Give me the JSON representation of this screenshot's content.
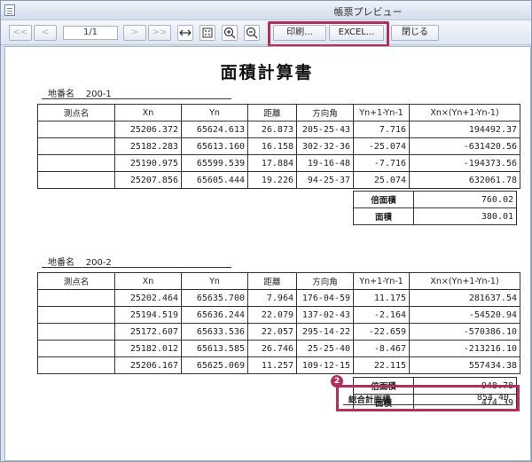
{
  "window": {
    "title": "帳票プレビュー"
  },
  "toolbar": {
    "first": "<<",
    "prev": "<",
    "page": "1/1",
    "next": ">",
    "last": ">>",
    "print_label": "印刷...",
    "excel_label": "EXCEL...",
    "close_label": "閉じる"
  },
  "document": {
    "title": "面積計算書",
    "columns": [
      "測点名",
      "Xn",
      "Yn",
      "距離",
      "方向角",
      "Yn+1-Yn-1",
      "Xn×(Yn+1-Yn-1)"
    ],
    "sum_labels": {
      "double_area": "倍面積",
      "area": "面積"
    },
    "total_label": "総合計面積",
    "total_value": "854.40",
    "badge": "2",
    "lots": [
      {
        "label": "地番名",
        "name": "200-1",
        "rows": [
          [
            "",
            "25206.372",
            "65624.613",
            "26.873",
            "205-25-43",
            "7.716",
            "194492.37"
          ],
          [
            "",
            "25182.283",
            "65613.160",
            "16.158",
            "302-32-36",
            "-25.074",
            "-631420.56"
          ],
          [
            "",
            "25190.975",
            "65599.539",
            "17.884",
            "19-16-48",
            "-7.716",
            "-194373.56"
          ],
          [
            "",
            "25207.856",
            "65605.444",
            "19.226",
            "94-25-37",
            "25.074",
            "632061.78"
          ]
        ],
        "double_area": "760.02",
        "area": "380.01"
      },
      {
        "label": "地番名",
        "name": "200-2",
        "rows": [
          [
            "",
            "25202.464",
            "65635.700",
            "7.964",
            "176-04-59",
            "11.175",
            "281637.54"
          ],
          [
            "",
            "25194.519",
            "65636.244",
            "22.079",
            "137-02-43",
            "-2.164",
            "-54520.94"
          ],
          [
            "",
            "25172.607",
            "65633.536",
            "22.057",
            "295-14-22",
            "-22.659",
            "-570386.10"
          ],
          [
            "",
            "25182.012",
            "65613.585",
            "26.746",
            "25-25-40",
            "-8.467",
            "-213216.10"
          ],
          [
            "",
            "25206.167",
            "65625.069",
            "11.257",
            "109-12-15",
            "22.115",
            "557434.38"
          ]
        ],
        "double_area": "948.78",
        "area": "474.39"
      }
    ]
  }
}
